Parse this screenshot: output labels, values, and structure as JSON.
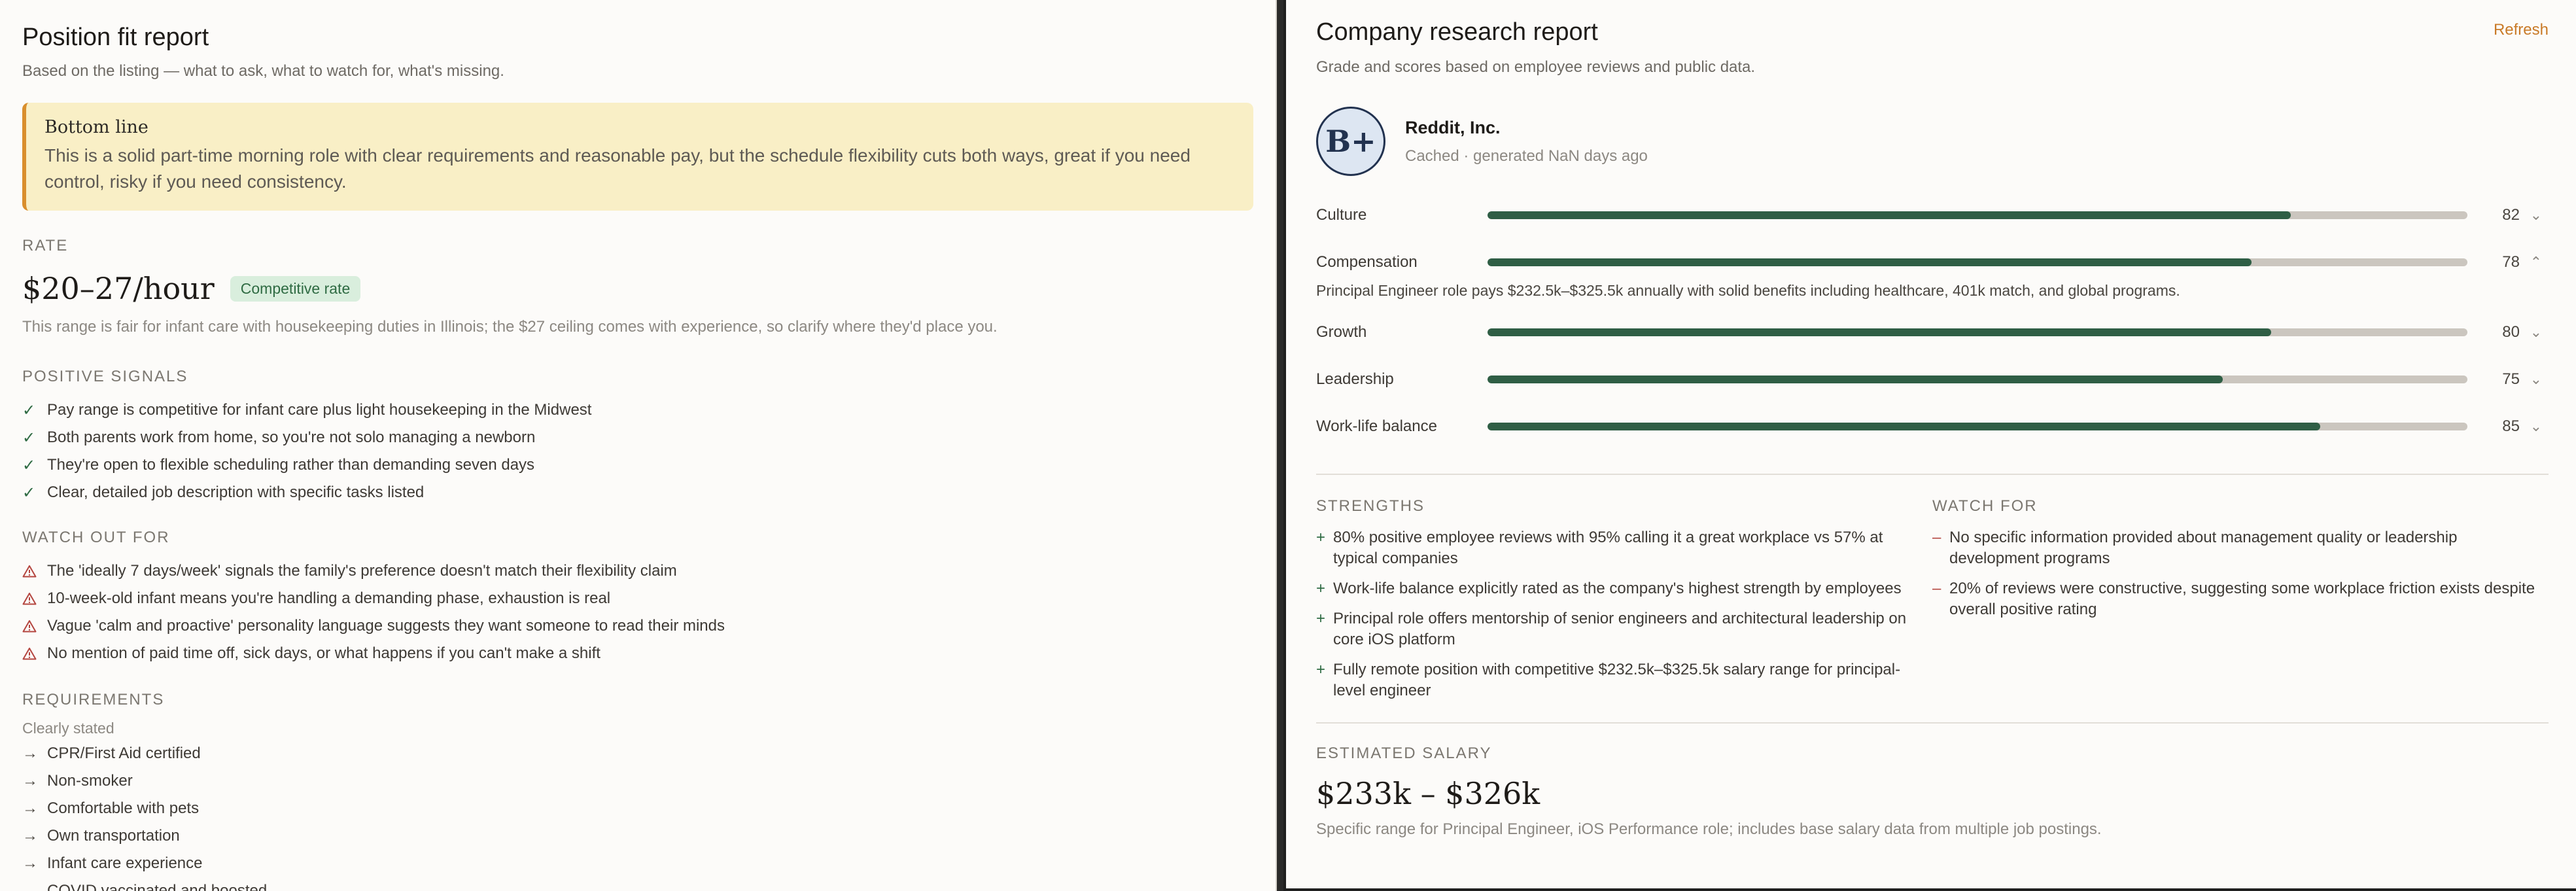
{
  "left": {
    "title": "Position fit report",
    "subtitle": "Based on the listing — what to ask, what to watch for, what's missing.",
    "bottom_line": {
      "title": "Bottom line",
      "text": "This is a solid part-time morning role with clear requirements and reasonable pay, but the schedule flexibility cuts both ways, great if you need control, risky if you need consistency."
    },
    "rate": {
      "label": "RATE",
      "value": "$20–27/hour",
      "badge": "Competitive rate",
      "note": "This range is fair for infant care with housekeeping duties in Illinois; the $27 ceiling comes with experience, so clarify where they'd place you."
    },
    "positive": {
      "label": "POSITIVE SIGNALS",
      "items": [
        "Pay range is competitive for infant care plus light housekeeping in the Midwest",
        "Both parents work from home, so you're not solo managing a newborn",
        "They're open to flexible scheduling rather than demanding seven days",
        "Clear, detailed job description with specific tasks listed"
      ]
    },
    "watch": {
      "label": "WATCH OUT FOR",
      "items": [
        "The 'ideally 7 days/week' signals the family's preference doesn't match their flexibility claim",
        "10-week-old infant means you're handling a demanding phase, exhaustion is real",
        "Vague 'calm and proactive' personality language suggests they want someone to read their minds",
        "No mention of paid time off, sick days, or what happens if you can't make a shift"
      ]
    },
    "requirements": {
      "label": "REQUIREMENTS",
      "subhead": "Clearly stated",
      "items": [
        "CPR/First Aid certified",
        "Non-smoker",
        "Comfortable with pets",
        "Own transportation",
        "Infant care experience",
        "COVID vaccinated and boosted"
      ]
    }
  },
  "right": {
    "title": "Company research report",
    "subtitle": "Grade and scores based on employee reviews and public data.",
    "refresh": "Refresh",
    "grade": "B+",
    "company": "Reddit, Inc.",
    "meta": "Cached · generated NaN days ago",
    "scores": [
      {
        "label": "Culture",
        "value": 82,
        "chevron": "⌄"
      },
      {
        "label": "Compensation",
        "value": 78,
        "chevron": "⌃",
        "detail": "Principal Engineer role pays $232.5k–$325.5k annually with solid benefits including healthcare, 401k match, and global programs."
      },
      {
        "label": "Growth",
        "value": 80,
        "chevron": "⌄"
      },
      {
        "label": "Leadership",
        "value": 75,
        "chevron": "⌄"
      },
      {
        "label": "Work-life balance",
        "value": 85,
        "chevron": "⌄"
      }
    ],
    "strengths": {
      "label": "STRENGTHS",
      "items": [
        "80% positive employee reviews with 95% calling it a great workplace vs 57% at typical companies",
        "Work-life balance explicitly rated as the company's highest strength by employees",
        "Principal role offers mentorship of senior engineers and architectural leadership on core iOS platform",
        "Fully remote position with competitive $232.5k–$325.5k salary range for principal-level engineer"
      ]
    },
    "watch_for": {
      "label": "WATCH FOR",
      "items": [
        "No specific information provided about management quality or leadership development programs",
        "20% of reviews were constructive, suggesting some workplace friction exists despite overall positive rating"
      ]
    },
    "salary": {
      "label": "ESTIMATED SALARY",
      "value": "$233k – $326k",
      "note": "Specific range for Principal Engineer, iOS Performance role; includes base salary data from multiple job postings."
    },
    "colors": {
      "bar_fill": "#2f5e45",
      "bar_track": "#cbc6bf",
      "accent": "#c97a27",
      "positive": "#2f6b43",
      "warning": "#b4453f"
    }
  }
}
